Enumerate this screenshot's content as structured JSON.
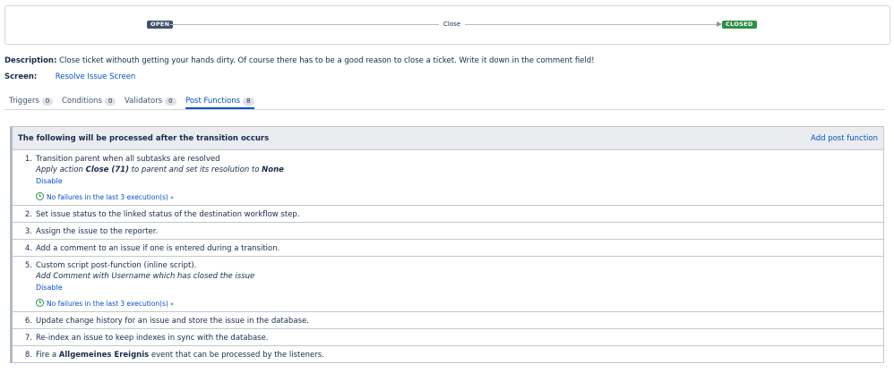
{
  "workflow": {
    "from_status": "OPEN",
    "transition": "Close",
    "to_status": "CLOSED",
    "colors": {
      "open": "#42526e",
      "closed": "#2f8f46",
      "link": "#0052cc"
    }
  },
  "description": {
    "label": "Description:",
    "text": "Close ticket withouth getting your hands dirty. Of course there has to be a good reason to close a ticket. Write it down in the comment field!"
  },
  "screen": {
    "label": "Screen:",
    "value": "Resolve Issue Screen"
  },
  "tabs": [
    {
      "label": "Triggers",
      "count": "0"
    },
    {
      "label": "Conditions",
      "count": "0"
    },
    {
      "label": "Validators",
      "count": "0"
    },
    {
      "label": "Post Functions",
      "count": "8",
      "active": true
    }
  ],
  "post_functions": {
    "header": "The following will be processed after the transition occurs",
    "add_label": "Add post function",
    "items": [
      {
        "num": "1.",
        "text": "Transition parent when all subtasks are resolved",
        "detail_pre": "Apply action ",
        "detail_b1": "Close (71)",
        "detail_mid": " to parent and set its resolution to ",
        "detail_b2": "None",
        "disable": "Disable",
        "status": "No failures in the last 3 execution(s)"
      },
      {
        "num": "2.",
        "text": "Set issue status to the linked status of the destination workflow step."
      },
      {
        "num": "3.",
        "text": "Assign the issue to the reporter."
      },
      {
        "num": "4.",
        "text": "Add a comment to an issue if one is entered during a transition."
      },
      {
        "num": "5.",
        "text": "Custom script post-function (inline script).",
        "detail": "Add Comment with Username which has closed the issue",
        "disable": "Disable",
        "status": "No failures in the last 3 execution(s)"
      },
      {
        "num": "6.",
        "text": "Update change history for an issue and store the issue in the database."
      },
      {
        "num": "7.",
        "text": "Re-index an issue to keep indexes in sync with the database."
      },
      {
        "num": "8.",
        "text_pre": "Fire a ",
        "text_bold": "Allgemeines Ereignis",
        "text_post": " event that can be processed by the listeners."
      }
    ]
  }
}
